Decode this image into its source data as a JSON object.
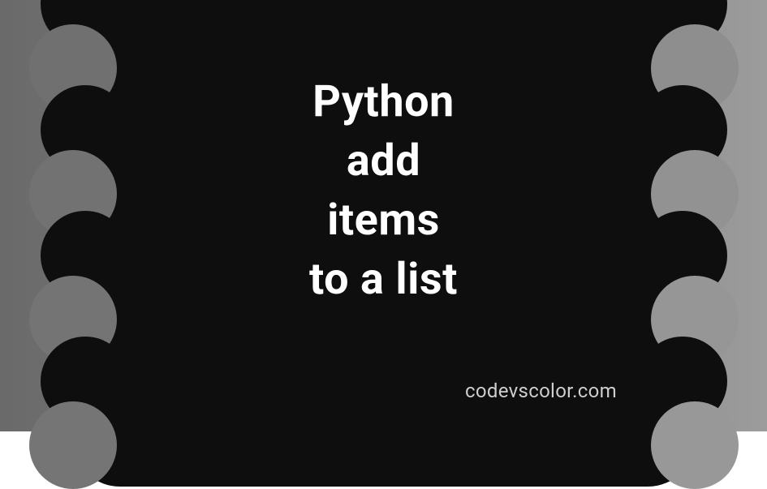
{
  "title": {
    "line1": "Python",
    "line2": "add",
    "line3": "items",
    "line4": "to a list"
  },
  "watermark": "codevscolor.com",
  "colors": {
    "blob": "#0e0e0f",
    "text": "#ffffff",
    "watermark": "#cfcfcf"
  }
}
